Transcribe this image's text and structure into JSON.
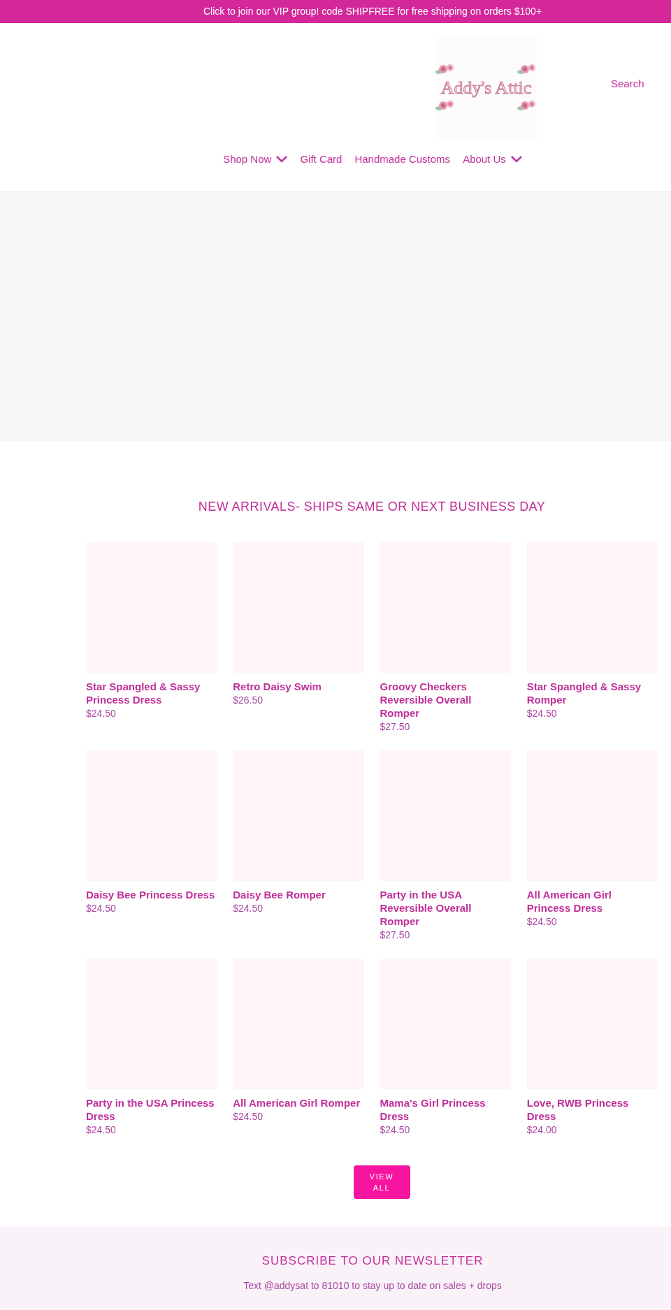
{
  "announcement": "Click to join our VIP group! code SHIPFREE for free shipping on orders $100+",
  "logo": {
    "text": "Addy's Attic"
  },
  "search": "Search",
  "nav": [
    {
      "label": "Shop Now",
      "dropdown": true
    },
    {
      "label": "Gift Card",
      "dropdown": false
    },
    {
      "label": "Handmade Customs",
      "dropdown": false
    },
    {
      "label": "About Us",
      "dropdown": true
    }
  ],
  "section_title": "NEW ARRIVALS- SHIPS SAME OR NEXT BUSINESS DAY",
  "products": [
    {
      "title": "Star Spangled & Sassy Princess Dress",
      "price": "$24.50"
    },
    {
      "title": "Retro Daisy Swim",
      "price": "$26.50"
    },
    {
      "title": "Groovy Checkers Reversible Overall Romper",
      "price": "$27.50"
    },
    {
      "title": "Star Spangled & Sassy Romper",
      "price": "$24.50"
    },
    {
      "title": "Daisy Bee Princess Dress",
      "price": "$24.50"
    },
    {
      "title": "Daisy Bee Romper",
      "price": "$24.50"
    },
    {
      "title": "Party in the USA Reversible Overall Romper",
      "price": "$27.50"
    },
    {
      "title": "All American Girl Princess Dress",
      "price": "$24.50"
    },
    {
      "title": "Party in the USA Princess Dress",
      "price": "$24.50"
    },
    {
      "title": "All American Girl Romper",
      "price": "$24.50"
    },
    {
      "title": "Mama's Girl Princess Dress",
      "price": "$24.50"
    },
    {
      "title": "Love, RWB Princess Dress",
      "price": "$24.00"
    }
  ],
  "view_all": [
    "VIEW",
    "ALL"
  ],
  "newsletter": {
    "title": "SUBSCRIBE TO OUR NEWSLETTER",
    "text": "Text @addysat to 81010 to stay up to date on sales + drops"
  }
}
